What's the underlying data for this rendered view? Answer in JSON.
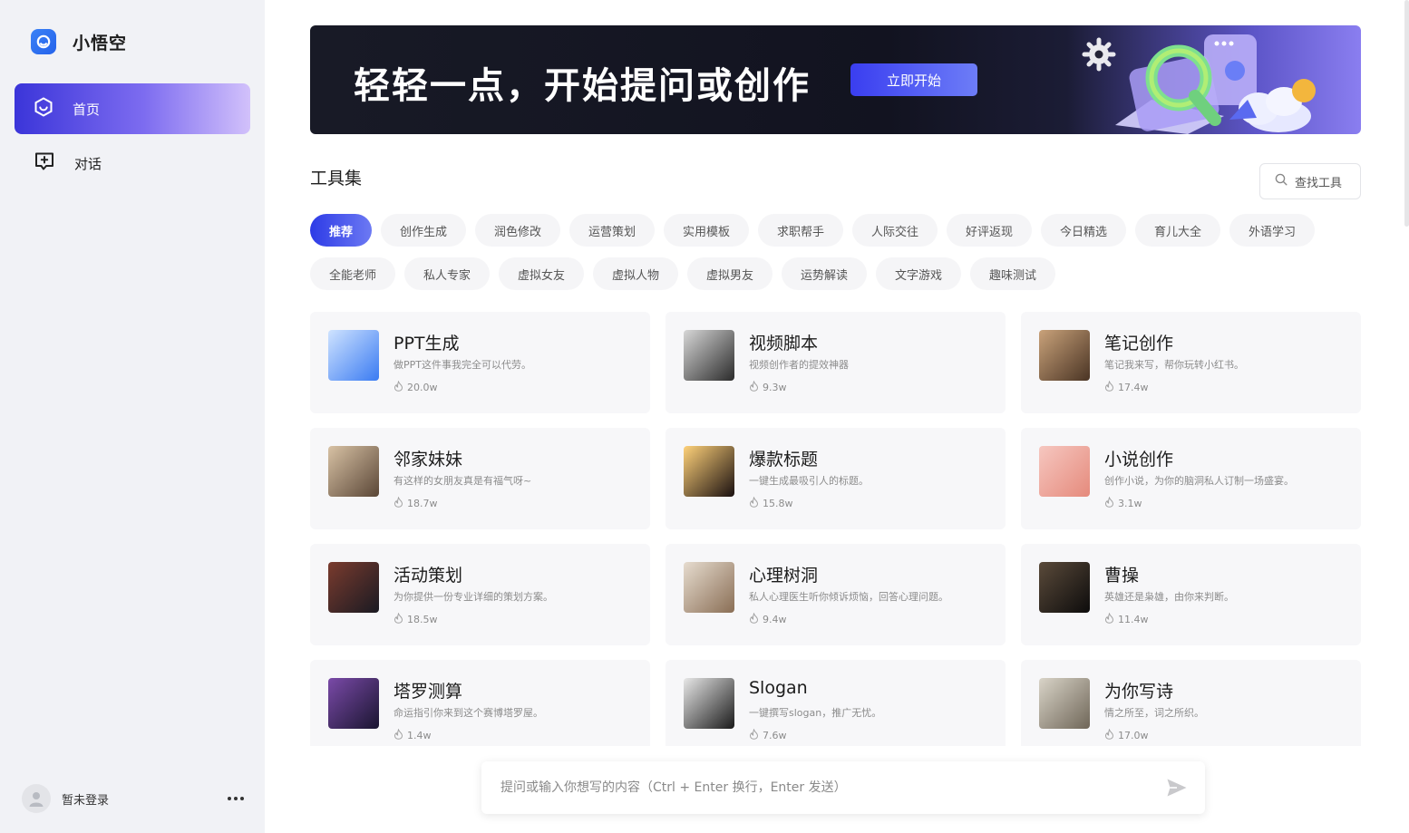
{
  "sidebar": {
    "brand": "小悟空",
    "nav": [
      {
        "label": "首页",
        "icon": "home-hex-icon",
        "active": true
      },
      {
        "label": "对话",
        "icon": "chat-plus-icon",
        "active": false
      }
    ],
    "user": {
      "name": "暂未登录",
      "more": "..."
    }
  },
  "banner": {
    "title": "轻轻一点，开始提问或创作",
    "button": "立即开始"
  },
  "tools": {
    "title": "工具集",
    "search_label": "查找工具",
    "categories": [
      "推荐",
      "创作生成",
      "润色修改",
      "运营策划",
      "实用模板",
      "求职帮手",
      "人际交往",
      "好评返现",
      "今日精选",
      "育儿大全",
      "外语学习",
      "全能老师",
      "私人专家",
      "虚拟女友",
      "虚拟人物",
      "虚拟男友",
      "运势解读",
      "文字游戏",
      "趣味测试"
    ],
    "active_category": "推荐"
  },
  "cards": [
    {
      "title": "PPT生成",
      "desc": "做PPT这件事我完全可以代劳。",
      "count": "20.0w",
      "thumb": "ppt-3d-icon",
      "colors": [
        "#cfe3ff",
        "#3a7bf2"
      ]
    },
    {
      "title": "视频脚本",
      "desc": "视频创作者的提效神器",
      "count": "9.3w",
      "thumb": "camera-photo",
      "colors": [
        "#d7d7d7",
        "#2b2b2b"
      ]
    },
    {
      "title": "笔记创作",
      "desc": "笔记我来写，帮你玩转小红书。",
      "count": "17.4w",
      "thumb": "woman-writing-photo",
      "colors": [
        "#c9a27a",
        "#4a3424"
      ]
    },
    {
      "title": "邻家妹妹",
      "desc": "有这样的女朋友真是有福气呀~",
      "count": "18.7w",
      "thumb": "smiling-girl-photo",
      "colors": [
        "#d8c2a5",
        "#5a4636"
      ]
    },
    {
      "title": "爆款标题",
      "desc": "一键生成最吸引人的标题。",
      "count": "15.8w",
      "thumb": "explosion-photo",
      "colors": [
        "#ffd27a",
        "#1a1010"
      ]
    },
    {
      "title": "小说创作",
      "desc": "创作小说，为你的脑洞私人订制一场盛宴。",
      "count": "3.1w",
      "thumb": "pen-paper-photo",
      "colors": [
        "#f6c7c0",
        "#e58a7c"
      ]
    },
    {
      "title": "活动策划",
      "desc": "为你提供一份专业详细的策划方案。",
      "count": "18.5w",
      "thumb": "party-photo",
      "colors": [
        "#7a3b2e",
        "#1a1a22"
      ]
    },
    {
      "title": "心理树洞",
      "desc": "私人心理医生听你倾诉烦恼，回答心理问题。",
      "count": "9.4w",
      "thumb": "hands-table-photo",
      "colors": [
        "#e6dccf",
        "#8a6e55"
      ]
    },
    {
      "title": "曹操",
      "desc": "英雄还是枭雄，由你来判断。",
      "count": "11.4w",
      "thumb": "cao-cao-portrait",
      "colors": [
        "#5a4a3a",
        "#0d0c0c"
      ]
    },
    {
      "title": "塔罗测算",
      "desc": "命运指引你来到这个赛博塔罗屋。",
      "count": "1.4w",
      "thumb": "tarot-woman-art",
      "colors": [
        "#7a4aa8",
        "#1a1530"
      ]
    },
    {
      "title": "Slogan",
      "desc": "一键撰写slogan，推广无忧。",
      "count": "7.6w",
      "thumb": "slogan-sign-photo",
      "colors": [
        "#e8e8e8",
        "#1a1a1a"
      ]
    },
    {
      "title": "为你写诗",
      "desc": "情之所至，词之所织。",
      "count": "17.0w",
      "thumb": "poet-writing-photo",
      "colors": [
        "#d9d4c8",
        "#6f6658"
      ]
    }
  ],
  "prompt": {
    "placeholder": "提问或输入你想写的内容（Ctrl + Enter 换行，Enter 发送）"
  }
}
